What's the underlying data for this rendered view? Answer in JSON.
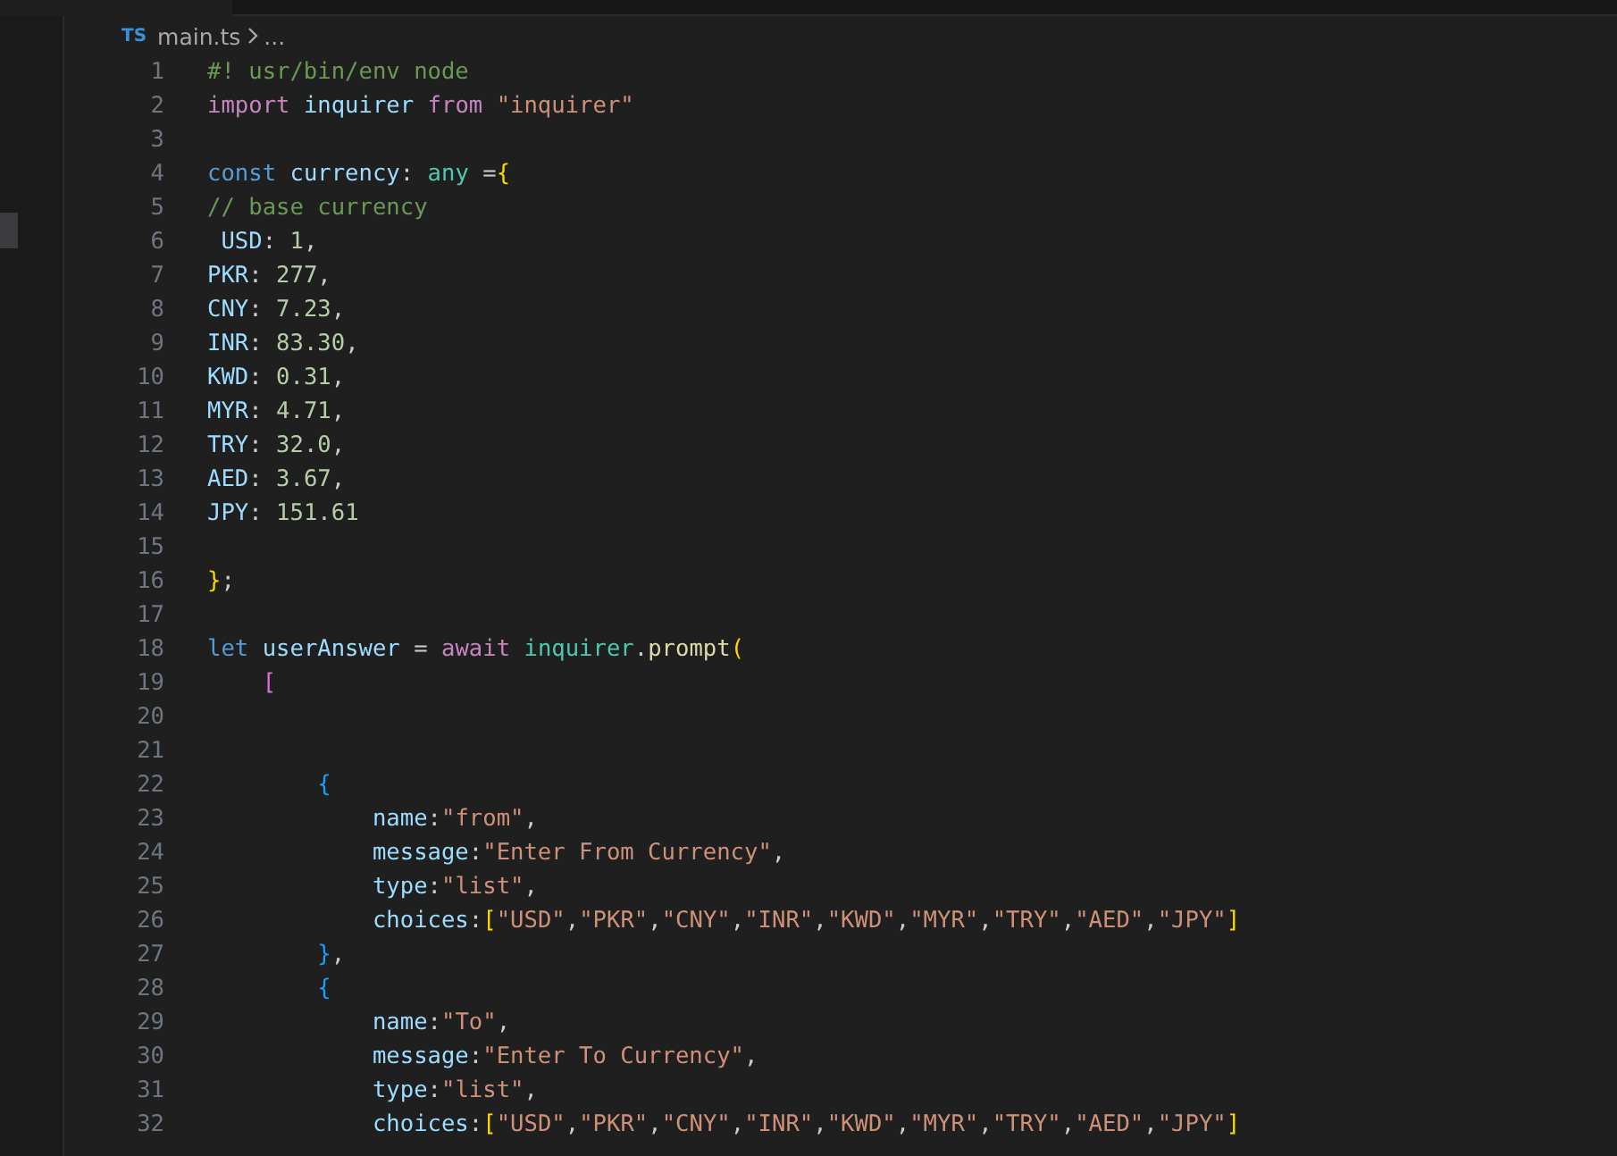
{
  "breadcrumb": {
    "file_badge": "TS",
    "file": "main.ts",
    "tail": "..."
  },
  "lines": [
    {
      "number": "1",
      "tokens": [
        {
          "kind": "comment",
          "text": "#! usr/bin/env node"
        }
      ]
    },
    {
      "number": "2",
      "tokens": [
        {
          "kind": "control",
          "text": "import "
        },
        {
          "kind": "variable",
          "text": "inquirer "
        },
        {
          "kind": "control",
          "text": "from "
        },
        {
          "kind": "string",
          "text": "\"inquirer\""
        }
      ]
    },
    {
      "number": "3"
    },
    {
      "number": "4",
      "tokens": [
        {
          "kind": "keyword",
          "text": "const "
        },
        {
          "kind": "variable",
          "text": "currency"
        },
        {
          "kind": "punct",
          "text": ": "
        },
        {
          "kind": "type",
          "text": "any "
        },
        {
          "kind": "punct",
          "text": "="
        },
        {
          "kind": "bracket1",
          "text": "{"
        }
      ]
    },
    {
      "number": "5",
      "tokens": [
        {
          "kind": "comment",
          "text": "// base currency"
        }
      ]
    },
    {
      "number": "6",
      "tokens": [
        {
          "kind": "variable",
          "text": " USD"
        },
        {
          "kind": "punct",
          "text": ": "
        },
        {
          "kind": "number",
          "text": "1"
        },
        {
          "kind": "punct",
          "text": ","
        }
      ]
    },
    {
      "number": "7",
      "tokens": [
        {
          "kind": "variable",
          "text": "PKR"
        },
        {
          "kind": "punct",
          "text": ": "
        },
        {
          "kind": "number",
          "text": "277"
        },
        {
          "kind": "punct",
          "text": ","
        }
      ]
    },
    {
      "number": "8",
      "tokens": [
        {
          "kind": "variable",
          "text": "CNY"
        },
        {
          "kind": "punct",
          "text": ": "
        },
        {
          "kind": "number",
          "text": "7.23"
        },
        {
          "kind": "punct",
          "text": ","
        }
      ]
    },
    {
      "number": "9",
      "tokens": [
        {
          "kind": "variable",
          "text": "INR"
        },
        {
          "kind": "punct",
          "text": ": "
        },
        {
          "kind": "number",
          "text": "83.30"
        },
        {
          "kind": "punct",
          "text": ","
        }
      ]
    },
    {
      "number": "10",
      "tokens": [
        {
          "kind": "variable",
          "text": "KWD"
        },
        {
          "kind": "punct",
          "text": ": "
        },
        {
          "kind": "number",
          "text": "0.31"
        },
        {
          "kind": "punct",
          "text": ","
        }
      ]
    },
    {
      "number": "11",
      "tokens": [
        {
          "kind": "variable",
          "text": "MYR"
        },
        {
          "kind": "punct",
          "text": ": "
        },
        {
          "kind": "number",
          "text": "4.71"
        },
        {
          "kind": "punct",
          "text": ","
        }
      ]
    },
    {
      "number": "12",
      "tokens": [
        {
          "kind": "variable",
          "text": "TRY"
        },
        {
          "kind": "punct",
          "text": ": "
        },
        {
          "kind": "number",
          "text": "32.0"
        },
        {
          "kind": "punct",
          "text": ","
        }
      ]
    },
    {
      "number": "13",
      "tokens": [
        {
          "kind": "variable",
          "text": "AED"
        },
        {
          "kind": "punct",
          "text": ": "
        },
        {
          "kind": "number",
          "text": "3.67"
        },
        {
          "kind": "punct",
          "text": ","
        }
      ]
    },
    {
      "number": "14",
      "tokens": [
        {
          "kind": "variable",
          "text": "JPY"
        },
        {
          "kind": "punct",
          "text": ": "
        },
        {
          "kind": "number",
          "text": "151.61"
        }
      ]
    },
    {
      "number": "15"
    },
    {
      "number": "16",
      "tokens": [
        {
          "kind": "bracket1",
          "text": "}"
        },
        {
          "kind": "punct",
          "text": ";"
        }
      ]
    },
    {
      "number": "17"
    },
    {
      "number": "18",
      "tokens": [
        {
          "kind": "keyword",
          "text": "let "
        },
        {
          "kind": "variable",
          "text": "userAnswer "
        },
        {
          "kind": "punct",
          "text": "= "
        },
        {
          "kind": "control",
          "text": "await "
        },
        {
          "kind": "type",
          "text": "inquirer"
        },
        {
          "kind": "punct",
          "text": "."
        },
        {
          "kind": "function",
          "text": "prompt"
        },
        {
          "kind": "bracket1",
          "text": "("
        }
      ]
    },
    {
      "number": "19",
      "tokens": [
        {
          "kind": "bracket2",
          "text": "    ["
        }
      ]
    },
    {
      "number": "20"
    },
    {
      "number": "21"
    },
    {
      "number": "22",
      "tokens": [
        {
          "kind": "bracket3",
          "text": "        {"
        }
      ]
    },
    {
      "number": "23",
      "tokens": [
        {
          "kind": "variable",
          "text": "            name"
        },
        {
          "kind": "punct",
          "text": ":"
        },
        {
          "kind": "string",
          "text": "\"from\""
        },
        {
          "kind": "punct",
          "text": ","
        }
      ]
    },
    {
      "number": "24",
      "tokens": [
        {
          "kind": "variable",
          "text": "            message"
        },
        {
          "kind": "punct",
          "text": ":"
        },
        {
          "kind": "string",
          "text": "\"Enter From Currency\""
        },
        {
          "kind": "punct",
          "text": ","
        }
      ]
    },
    {
      "number": "25",
      "tokens": [
        {
          "kind": "variable",
          "text": "            type"
        },
        {
          "kind": "punct",
          "text": ":"
        },
        {
          "kind": "string",
          "text": "\"list\""
        },
        {
          "kind": "punct",
          "text": ","
        }
      ]
    },
    {
      "number": "26",
      "tokens": [
        {
          "kind": "variable",
          "text": "            choices"
        },
        {
          "kind": "punct",
          "text": ":"
        },
        {
          "kind": "bracket1",
          "text": "["
        },
        {
          "kind": "string",
          "text": "\"USD\""
        },
        {
          "kind": "punct",
          "text": ","
        },
        {
          "kind": "string",
          "text": "\"PKR\""
        },
        {
          "kind": "punct",
          "text": ","
        },
        {
          "kind": "string",
          "text": "\"CNY\""
        },
        {
          "kind": "punct",
          "text": ","
        },
        {
          "kind": "string",
          "text": "\"INR\""
        },
        {
          "kind": "punct",
          "text": ","
        },
        {
          "kind": "string",
          "text": "\"KWD\""
        },
        {
          "kind": "punct",
          "text": ","
        },
        {
          "kind": "string",
          "text": "\"MYR\""
        },
        {
          "kind": "punct",
          "text": ","
        },
        {
          "kind": "string",
          "text": "\"TRY\""
        },
        {
          "kind": "punct",
          "text": ","
        },
        {
          "kind": "string",
          "text": "\"AED\""
        },
        {
          "kind": "punct",
          "text": ","
        },
        {
          "kind": "string",
          "text": "\"JPY\""
        },
        {
          "kind": "bracket1",
          "text": "]"
        }
      ]
    },
    {
      "number": "27",
      "tokens": [
        {
          "kind": "bracket3",
          "text": "        }"
        },
        {
          "kind": "punct",
          "text": ","
        }
      ]
    },
    {
      "number": "28",
      "tokens": [
        {
          "kind": "bracket3",
          "text": "        {"
        }
      ]
    },
    {
      "number": "29",
      "tokens": [
        {
          "kind": "variable",
          "text": "            name"
        },
        {
          "kind": "punct",
          "text": ":"
        },
        {
          "kind": "string",
          "text": "\"To\""
        },
        {
          "kind": "punct",
          "text": ","
        }
      ]
    },
    {
      "number": "30",
      "tokens": [
        {
          "kind": "variable",
          "text": "            message"
        },
        {
          "kind": "punct",
          "text": ":"
        },
        {
          "kind": "string",
          "text": "\"Enter To Currency\""
        },
        {
          "kind": "punct",
          "text": ","
        }
      ]
    },
    {
      "number": "31",
      "tokens": [
        {
          "kind": "variable",
          "text": "            type"
        },
        {
          "kind": "punct",
          "text": ":"
        },
        {
          "kind": "string",
          "text": "\"list\""
        },
        {
          "kind": "punct",
          "text": ","
        }
      ]
    },
    {
      "number": "32",
      "tokens": [
        {
          "kind": "variable",
          "text": "            choices"
        },
        {
          "kind": "punct",
          "text": ":"
        },
        {
          "kind": "bracket1",
          "text": "["
        },
        {
          "kind": "string",
          "text": "\"USD\""
        },
        {
          "kind": "punct",
          "text": ","
        },
        {
          "kind": "string",
          "text": "\"PKR\""
        },
        {
          "kind": "punct",
          "text": ","
        },
        {
          "kind": "string",
          "text": "\"CNY\""
        },
        {
          "kind": "punct",
          "text": ","
        },
        {
          "kind": "string",
          "text": "\"INR\""
        },
        {
          "kind": "punct",
          "text": ","
        },
        {
          "kind": "string",
          "text": "\"KWD\""
        },
        {
          "kind": "punct",
          "text": ","
        },
        {
          "kind": "string",
          "text": "\"MYR\""
        },
        {
          "kind": "punct",
          "text": ","
        },
        {
          "kind": "string",
          "text": "\"TRY\""
        },
        {
          "kind": "punct",
          "text": ","
        },
        {
          "kind": "string",
          "text": "\"AED\""
        },
        {
          "kind": "punct",
          "text": ","
        },
        {
          "kind": "string",
          "text": "\"JPY\""
        },
        {
          "kind": "bracket1",
          "text": "]"
        }
      ]
    }
  ]
}
